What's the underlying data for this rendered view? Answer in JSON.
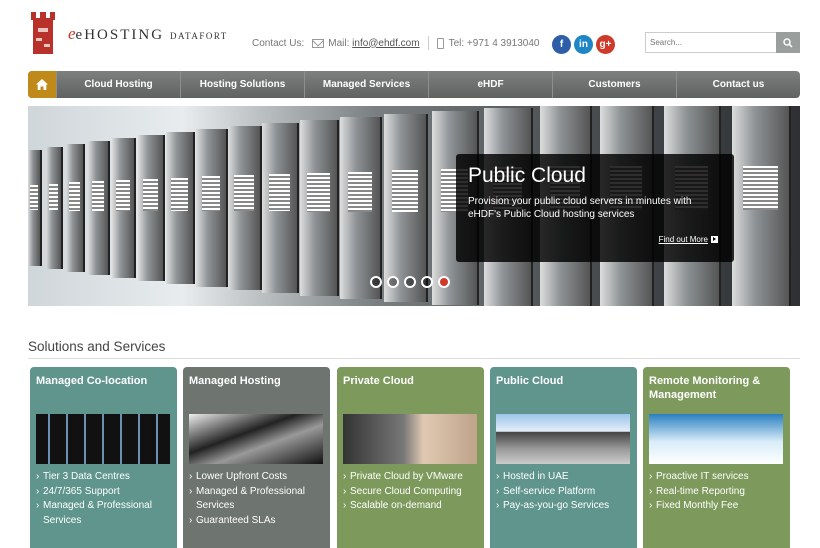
{
  "header": {
    "logo_brand": "eHOSTING",
    "logo_sub": "DATAFORT",
    "contact_label": "Contact Us:",
    "mail_label": "Mail:",
    "mail_link": "info@ehdf.com",
    "tel_label": "Tel: +971 4 3913040",
    "social": {
      "facebook": "f",
      "linkedin": "in",
      "googleplus": "g+"
    },
    "search_placeholder": "Search..."
  },
  "nav": {
    "items": [
      "Cloud Hosting",
      "Hosting Solutions",
      "Managed Services",
      "eHDF",
      "Customers",
      "Contact us"
    ]
  },
  "hero": {
    "title": "Public Cloud",
    "text": "Provision your public cloud servers in minutes with eHDF's Public Cloud hosting services",
    "link": "Find out More",
    "slides": 5,
    "active_slide": 5
  },
  "solutions": {
    "title": "Solutions and Services",
    "cards": [
      {
        "title": "Managed Co-location",
        "items": [
          "Tier 3 Data Centres",
          "24/7/365 Support",
          "Managed & Professional Services"
        ],
        "color": "#5f958d"
      },
      {
        "title": "Managed Hosting",
        "items": [
          "Lower Upfront Costs",
          "Managed & Professional Services",
          "Guaranteed SLAs"
        ],
        "color": "#6e7470"
      },
      {
        "title": "Private Cloud",
        "items": [
          "Private Cloud by VMware",
          "Secure Cloud Computing",
          "Scalable on-demand"
        ],
        "color": "#7d9a5c"
      },
      {
        "title": "Public Cloud",
        "items": [
          "Hosted in UAE",
          "Self-service Platform",
          "Pay-as-you-go Services"
        ],
        "color": "#5f958d"
      },
      {
        "title": "Remote Monitoring & Management",
        "items": [
          "Proactive IT services",
          "Real-time Reporting",
          "Fixed Monthly Fee"
        ],
        "color": "#7d9a5c"
      }
    ]
  },
  "colors": {
    "nav": "#6b6e6d",
    "home": "#c08a1b",
    "accent_red": "#d03a2b"
  }
}
